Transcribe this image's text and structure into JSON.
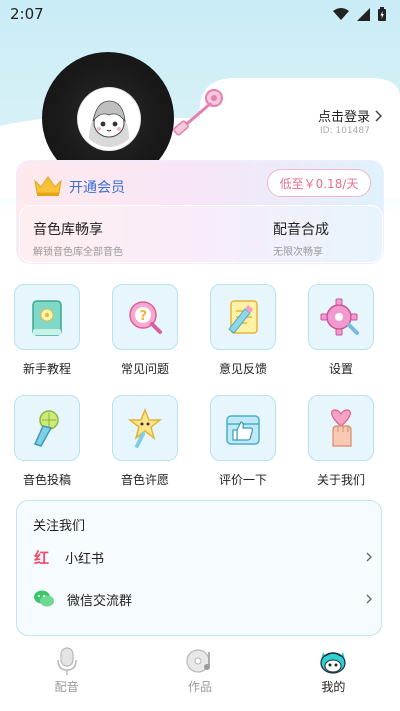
{
  "status": {
    "time": "2:07"
  },
  "profile": {
    "login_label": "点击登录",
    "user_id": "ID: 101487"
  },
  "vip": {
    "title": "开通会员",
    "price": "低至￥0.18/天",
    "features": [
      {
        "title": "音色库畅享",
        "subtitle": "解锁音色库全部音色"
      },
      {
        "title": "配音合成",
        "subtitle": "无限次畅享"
      }
    ]
  },
  "grid": [
    {
      "label": "新手教程",
      "icon": "tutorial-book-icon"
    },
    {
      "label": "常见问题",
      "icon": "faq-question-icon"
    },
    {
      "label": "意见反馈",
      "icon": "feedback-notepad-icon"
    },
    {
      "label": "设置",
      "icon": "settings-gear-icon"
    },
    {
      "label": "音色投稿",
      "icon": "microphone-icon"
    },
    {
      "label": "音色许愿",
      "icon": "wish-star-wand-icon"
    },
    {
      "label": "评价一下",
      "icon": "thumbs-up-icon"
    },
    {
      "label": "关于我们",
      "icon": "heart-hand-icon"
    }
  ],
  "follow": {
    "title": "关注我们",
    "items": [
      {
        "label": "小红书",
        "icon": "xiaohongshu-icon"
      },
      {
        "label": "微信交流群",
        "icon": "wechat-icon"
      }
    ]
  },
  "tabs": [
    {
      "label": "配音",
      "icon": "microphone-tab-icon"
    },
    {
      "label": "作品",
      "icon": "works-disc-icon"
    },
    {
      "label": "我的",
      "icon": "mine-character-icon"
    }
  ],
  "colors": {
    "accent": "#3b6fd6",
    "price_pink": "#ea6f8f",
    "tile_bg": "#e6f6fc",
    "tile_border": "#b9e1f0"
  }
}
